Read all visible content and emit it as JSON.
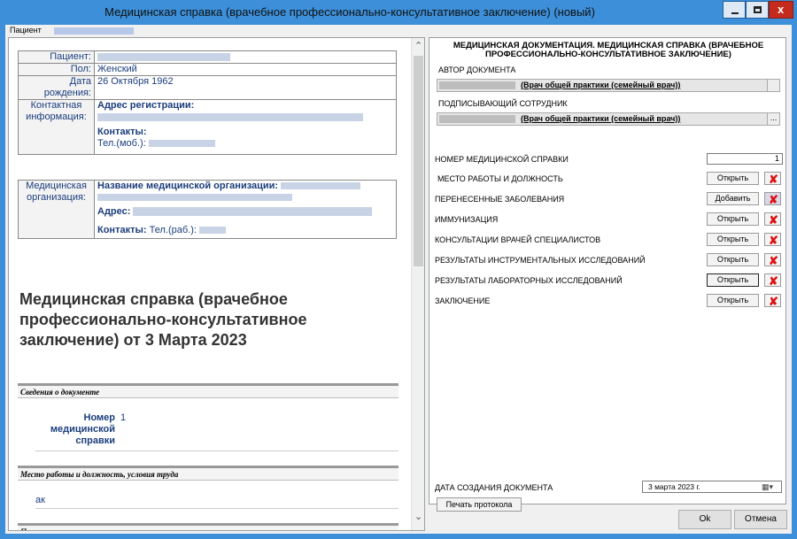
{
  "window": {
    "title": "Медицинская справка (врачебное профессионально-консультативное заключение) (новый)",
    "accent": "#3c8fd8",
    "close_color": "#c42b1c"
  },
  "patient_label": "Пациент",
  "document": {
    "patient_table": {
      "patient_label": "Пациент:",
      "sex_label": "Пол:",
      "sex_value": "Женский",
      "dob_label": "Дата рождения:",
      "dob_value": "26 Октября 1962",
      "contact_label": "Контактная информация:",
      "reg_address_label": "Адрес регистрации:",
      "contacts_label": "Контакты:",
      "phone_label": "Тел.(моб.):"
    },
    "org_table": {
      "org_label": "Медицинская организация:",
      "org_name_label": "Название медицинской организации:",
      "address_label": "Адрес:",
      "contacts_label": "Контакты:",
      "phone_label": "Тел.(раб.):"
    },
    "heading": "Медицинская справка (врачебное профессионально-консультативное заключение) от 3 Марта 2023",
    "section_info": "Сведения о документе",
    "cert_number_label": "Номер медицинской справки",
    "cert_number_value": "1",
    "section_work": "Место работы и должность, условия труда",
    "work_value": "ак",
    "section_next": "Пр"
  },
  "panel": {
    "title": "МЕДИЦИНСКАЯ ДОКУМЕНТАЦИЯ. МЕДИЦИНСКАЯ СПРАВКА (ВРАЧЕБНОЕ ПРОФЕССИОНАЛЬНО-КОНСУЛЬТАТИВНОЕ ЗАКЛЮЧЕНИЕ)",
    "author_label": "АВТОР ДОКУМЕНТА",
    "author_role": "(Врач общей практики (семейный врач))",
    "signer_label": "ПОДПИСЫВАЮЩИЙ СОТРУДНИК",
    "signer_role": "(Врач общей практики (семейный врач))",
    "dots": "...",
    "cert_number_label": "НОМЕР МЕДИЦИНСКОЙ СПРАВКИ",
    "cert_number_value": "1",
    "rows": [
      {
        "label": "МЕСТО РАБОТЫ И ДОЛЖНОСТЬ",
        "button": "Открыть"
      },
      {
        "label": "ПЕРЕНЕСЕННЫЕ ЗАБОЛЕВАНИЯ",
        "button": "Добавить"
      },
      {
        "label": "ИММУНИЗАЦИЯ",
        "button": "Открыть"
      },
      {
        "label": "КОНСУЛЬТАЦИИ ВРАЧЕЙ СПЕЦИАЛИСТОВ",
        "button": "Открыть"
      },
      {
        "label": "РЕЗУЛЬТАТЫ ИНСТРУМЕНТАЛЬНЫХ ИССЛЕДОВАНИЙ",
        "button": "Открыть"
      },
      {
        "label": "РЕЗУЛЬТАТЫ ЛАБОРАТОРНЫХ ИССЛЕДОВАНИЙ",
        "button": "Открыть"
      },
      {
        "label": "ЗАКЛЮЧЕНИЕ",
        "button": "Открыть"
      }
    ],
    "date_label": "ДАТА СОЗДАНИЯ ДОКУМЕНТА",
    "date_value": "3  марта  2023 г.",
    "print_button": "Печать протокола"
  },
  "footer": {
    "ok": "Ok",
    "cancel": "Отмена"
  }
}
